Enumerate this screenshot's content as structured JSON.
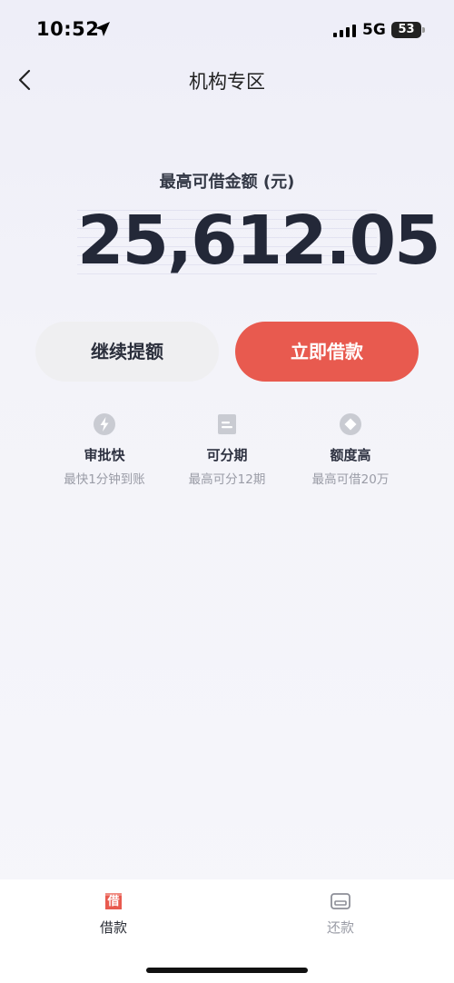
{
  "status_bar": {
    "time": "10:52",
    "network": "5G",
    "battery": "53"
  },
  "nav": {
    "title": "机构专区"
  },
  "amount": {
    "label": "最高可借金额 (元)",
    "value": "25,612.05"
  },
  "buttons": {
    "continue_label": "继续提额",
    "borrow_label": "立即借款"
  },
  "features": [
    {
      "icon": "lightning-icon",
      "title": "审批快",
      "subtitle": "最快1分钟到账"
    },
    {
      "icon": "document-icon",
      "title": "可分期",
      "subtitle": "最高可分12期"
    },
    {
      "icon": "diamond-icon",
      "title": "额度高",
      "subtitle": "最高可借20万"
    }
  ],
  "tabs": [
    {
      "icon": "borrow-tab-icon",
      "badge": "借",
      "label": "借款",
      "active": true
    },
    {
      "icon": "card-icon",
      "label": "还款",
      "active": false
    }
  ],
  "colors": {
    "accent": "#e85a4f",
    "text": "#232838",
    "muted": "#9a9ca6",
    "icon_gray": "#c9cbd2"
  }
}
